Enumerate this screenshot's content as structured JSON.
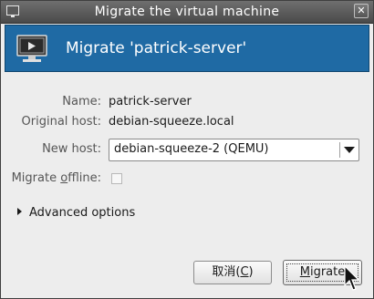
{
  "window": {
    "title": "Migrate the virtual machine",
    "close_glyph": "✕"
  },
  "banner": {
    "title": "Migrate 'patrick-server'",
    "icon": "monitor-icon",
    "color": "#1f6aa4"
  },
  "form": {
    "name_label": "Name:",
    "name_value": "patrick-server",
    "original_host_label": "Original host:",
    "original_host_value": "debian-squeeze.local",
    "new_host_label": "New host:",
    "new_host_value": "debian-squeeze-2 (QEMU)",
    "offline_label_prefix": "Migrate ",
    "offline_label_mnemonic": "o",
    "offline_label_suffix": "ffline:",
    "offline_checked": false
  },
  "advanced": {
    "label": "Advanced options",
    "expanded": false
  },
  "buttons": {
    "cancel_prefix": "取消(",
    "cancel_mnemonic": "C",
    "cancel_suffix": ")",
    "migrate_mnemonic": "M",
    "migrate_rest": "igrate"
  }
}
